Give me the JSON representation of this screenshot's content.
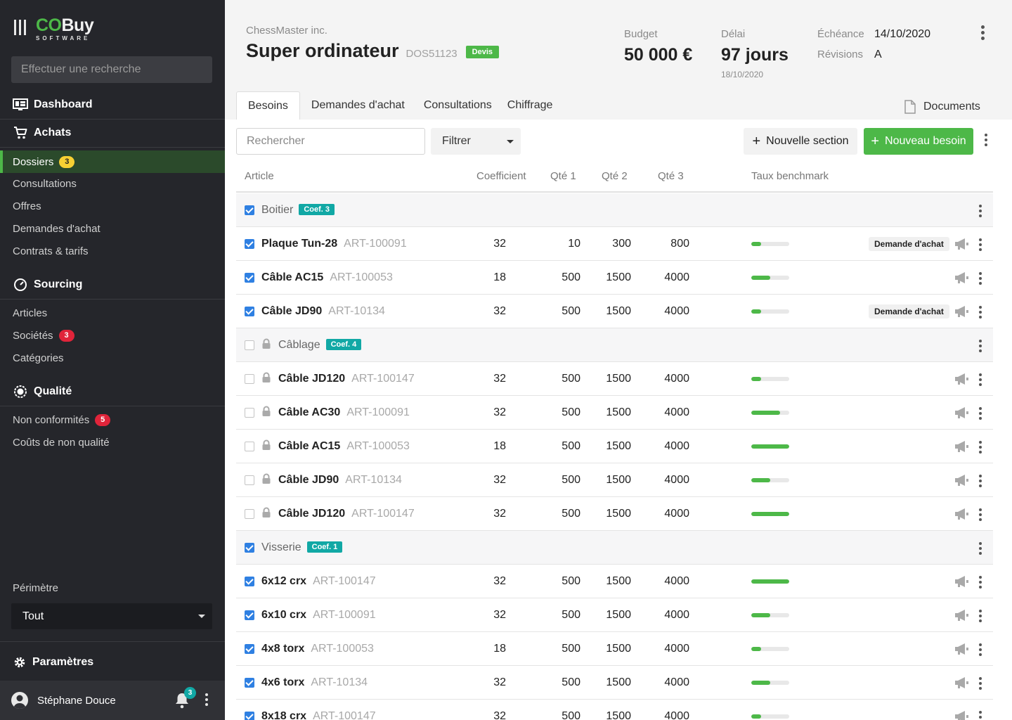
{
  "sidebar": {
    "logo": {
      "co": "CO",
      "buy": "Buy",
      "sub": "SOFTWARE"
    },
    "search_placeholder": "Effectuer une recherche",
    "dashboard": "Dashboard",
    "achats": {
      "label": "Achats",
      "items": [
        {
          "label": "Dossiers",
          "badge": "3",
          "badge_color": "#f7d033",
          "active": true
        },
        {
          "label": "Consultations"
        },
        {
          "label": "Offres"
        },
        {
          "label": "Demandes d'achat"
        },
        {
          "label": "Contrats & tarifs"
        }
      ]
    },
    "sourcing": {
      "label": "Sourcing",
      "items": [
        {
          "label": "Articles"
        },
        {
          "label": "Sociétés",
          "badge": "3",
          "badge_color": "#e0243a"
        },
        {
          "label": "Catégories"
        }
      ]
    },
    "qualite": {
      "label": "Qualité",
      "items": [
        {
          "label": "Non conformités",
          "badge": "5",
          "badge_color": "#e0243a"
        },
        {
          "label": "Coûts de non qualité"
        }
      ]
    },
    "perimetre_label": "Périmètre",
    "perimetre_value": "Tout",
    "parametres": "Paramètres",
    "user": {
      "name": "Stéphane Douce",
      "notifications": "3"
    }
  },
  "header": {
    "company": "ChessMaster inc.",
    "title": "Super ordinateur",
    "dossier_code": "DOS51123",
    "status": "Devis",
    "budget_label": "Budget",
    "budget_value": "50 000 €",
    "delai_label": "Délai",
    "delai_value": "97 jours",
    "delai_date": "18/10/2020",
    "echeance_label": "Échéance",
    "echeance_value": "14/10/2020",
    "revisions_label": "Révisions",
    "revisions_value": "A"
  },
  "tabs": [
    "Besoins",
    "Demandes d'achat",
    "Consultations",
    "Chiffrage"
  ],
  "active_tab": "Besoins",
  "documents_label": "Documents",
  "toolbar": {
    "search_placeholder": "Rechercher",
    "filter_label": "Filtrer",
    "new_section": "Nouvelle section",
    "new_need": "Nouveau besoin"
  },
  "columns": [
    "Article",
    "Coefficient",
    "Qté 1",
    "Qté 2",
    "Qté 3",
    "Taux benchmark"
  ],
  "rows": [
    {
      "type": "section",
      "name": "Boitier",
      "coef": "Coef. 3",
      "checked": true,
      "locked": false
    },
    {
      "type": "item",
      "name": "Plaque Tun-28",
      "code": "ART-100091",
      "coefficient": "32",
      "q1": "10",
      "q2": "300",
      "q3": "800",
      "benchmark": 0.25,
      "tag": "Demande d'achat",
      "checked": true,
      "locked": false
    },
    {
      "type": "item",
      "name": "Câble AC15",
      "code": "ART-100053",
      "coefficient": "18",
      "q1": "500",
      "q2": "1500",
      "q3": "4000",
      "benchmark": 0.5,
      "tag": "",
      "checked": true,
      "locked": false
    },
    {
      "type": "item",
      "name": "Câble JD90",
      "code": "ART-10134",
      "coefficient": "32",
      "q1": "500",
      "q2": "1500",
      "q3": "4000",
      "benchmark": 0.25,
      "tag": "Demande d'achat",
      "checked": true,
      "locked": false
    },
    {
      "type": "section",
      "name": "Câblage",
      "coef": "Coef. 4",
      "checked": false,
      "locked": true
    },
    {
      "type": "item",
      "name": "Câble JD120",
      "code": "ART-100147",
      "coefficient": "32",
      "q1": "500",
      "q2": "1500",
      "q3": "4000",
      "benchmark": 0.25,
      "tag": "",
      "checked": false,
      "locked": true
    },
    {
      "type": "item",
      "name": "Câble AC30",
      "code": "ART-100091",
      "coefficient": "32",
      "q1": "500",
      "q2": "1500",
      "q3": "4000",
      "benchmark": 0.75,
      "tag": "",
      "checked": false,
      "locked": true
    },
    {
      "type": "item",
      "name": "Câble AC15",
      "code": "ART-100053",
      "coefficient": "18",
      "q1": "500",
      "q2": "1500",
      "q3": "4000",
      "benchmark": 1.0,
      "tag": "",
      "checked": false,
      "locked": true
    },
    {
      "type": "item",
      "name": "Câble JD90",
      "code": "ART-10134",
      "coefficient": "32",
      "q1": "500",
      "q2": "1500",
      "q3": "4000",
      "benchmark": 0.5,
      "tag": "",
      "checked": false,
      "locked": true
    },
    {
      "type": "item",
      "name": "Câble JD120",
      "code": "ART-100147",
      "coefficient": "32",
      "q1": "500",
      "q2": "1500",
      "q3": "4000",
      "benchmark": 1.0,
      "tag": "",
      "checked": false,
      "locked": true
    },
    {
      "type": "section",
      "name": "Visserie",
      "coef": "Coef. 1",
      "checked": true,
      "locked": false
    },
    {
      "type": "item",
      "name": "6x12 crx",
      "code": "ART-100147",
      "coefficient": "32",
      "q1": "500",
      "q2": "1500",
      "q3": "4000",
      "benchmark": 1.0,
      "tag": "",
      "checked": true,
      "locked": false
    },
    {
      "type": "item",
      "name": "6x10 crx",
      "code": "ART-100091",
      "coefficient": "32",
      "q1": "500",
      "q2": "1500",
      "q3": "4000",
      "benchmark": 0.5,
      "tag": "",
      "checked": true,
      "locked": false
    },
    {
      "type": "item",
      "name": "4x8 torx",
      "code": "ART-100053",
      "coefficient": "18",
      "q1": "500",
      "q2": "1500",
      "q3": "4000",
      "benchmark": 0.25,
      "tag": "",
      "checked": true,
      "locked": false
    },
    {
      "type": "item",
      "name": "4x6 torx",
      "code": "ART-10134",
      "coefficient": "32",
      "q1": "500",
      "q2": "1500",
      "q3": "4000",
      "benchmark": 0.5,
      "tag": "",
      "checked": true,
      "locked": false
    },
    {
      "type": "item",
      "name": "8x18 crx",
      "code": "ART-100147",
      "coefficient": "32",
      "q1": "500",
      "q2": "1500",
      "q3": "4000",
      "benchmark": 0.25,
      "tag": "",
      "checked": true,
      "locked": false
    }
  ],
  "icons": {
    "lock": "lock-icon",
    "announce": "megaphone-icon",
    "more": "vertical-dots-icon",
    "document": "document-icon"
  }
}
